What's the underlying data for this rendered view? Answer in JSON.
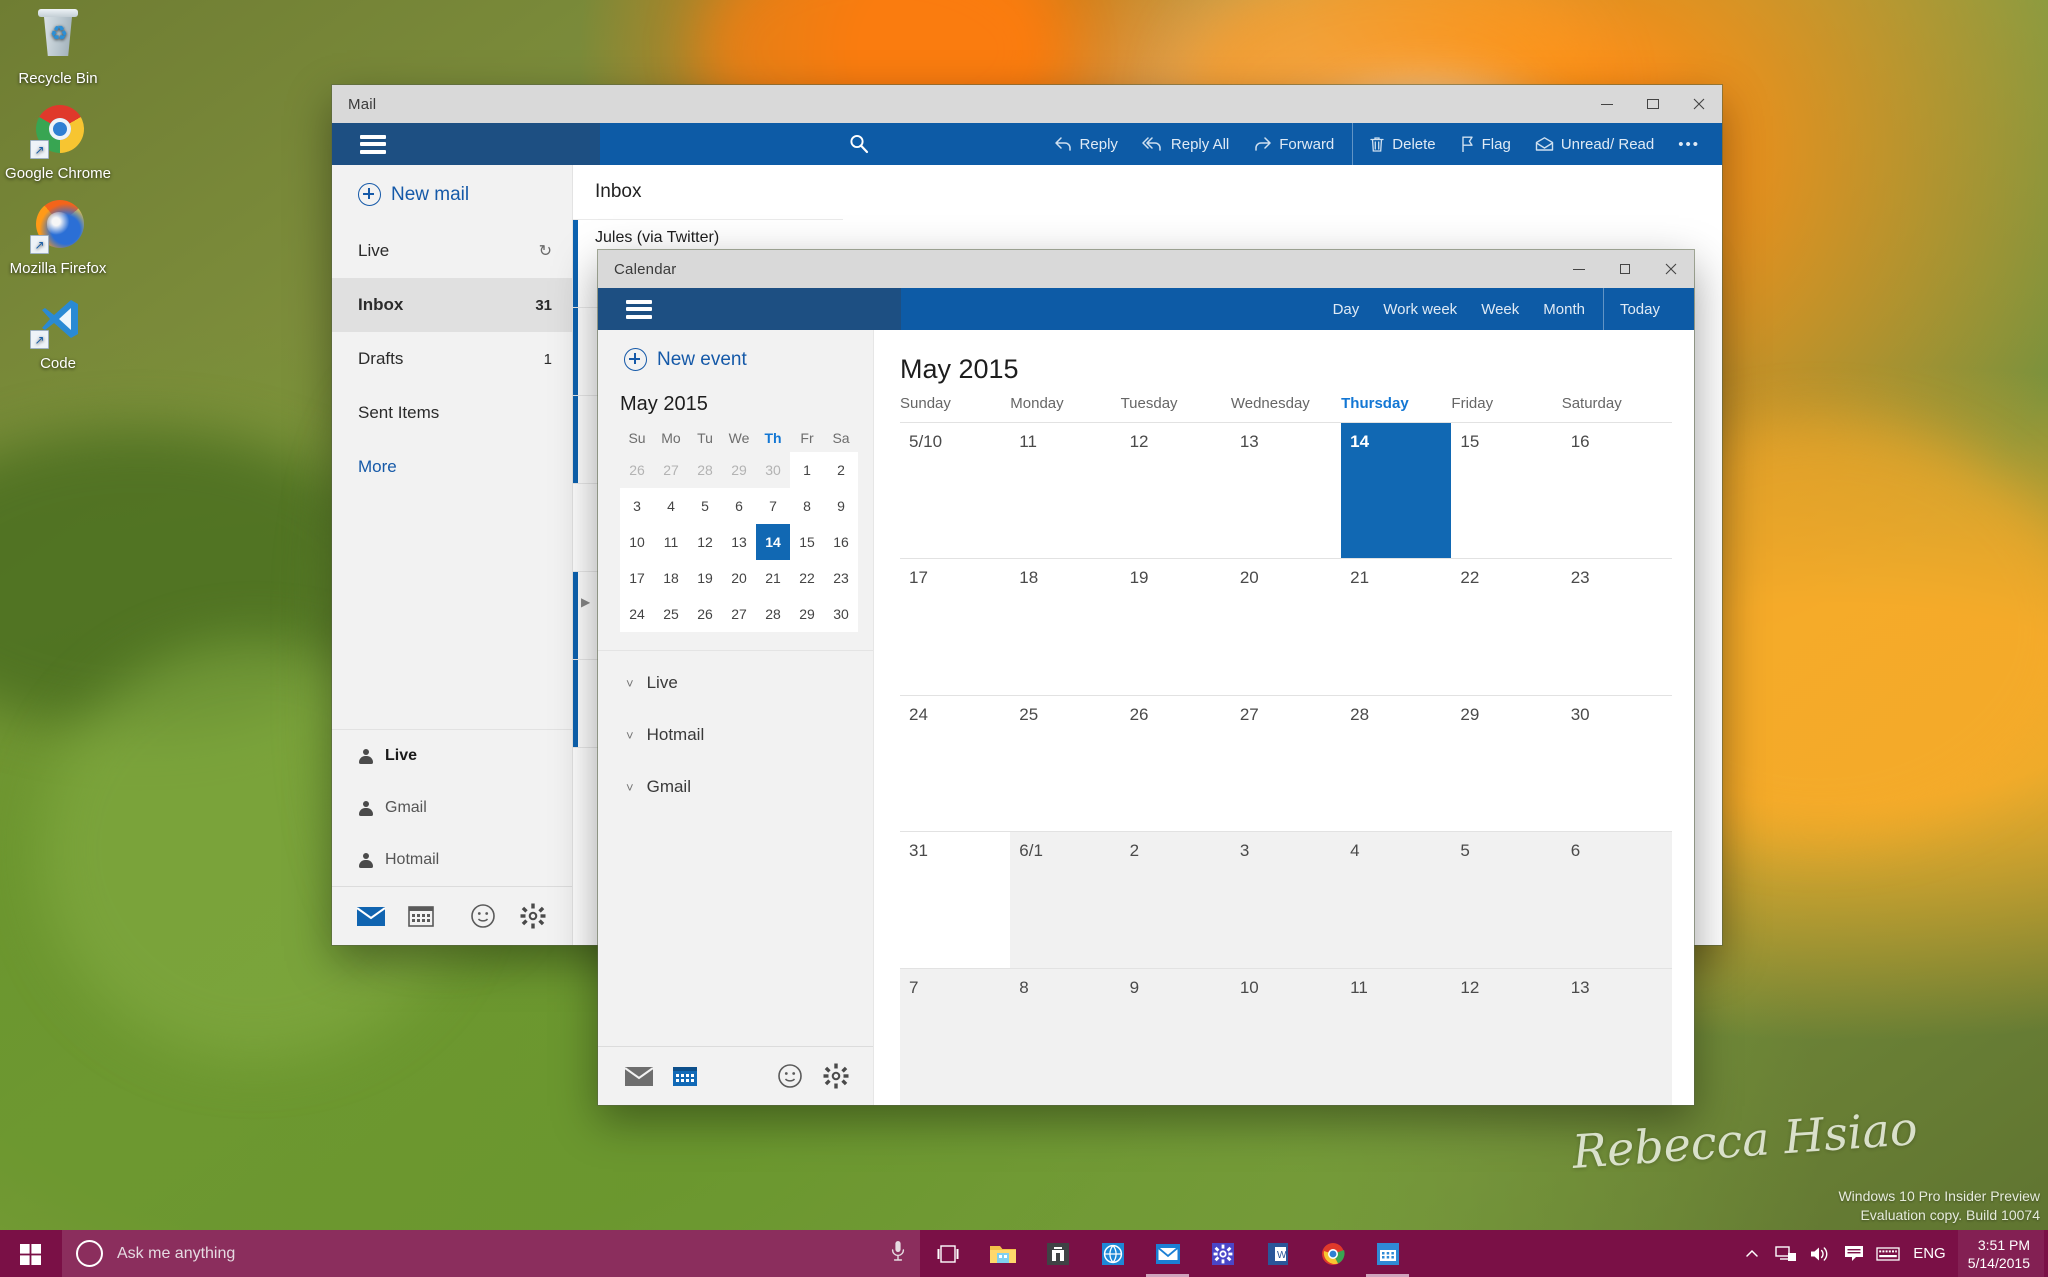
{
  "desktop": {
    "icons": [
      {
        "name": "Recycle Bin",
        "icon": "recycle-bin-icon"
      },
      {
        "name": "Google Chrome",
        "icon": "chrome-icon"
      },
      {
        "name": "Mozilla Firefox",
        "icon": "firefox-icon"
      },
      {
        "name": "Code",
        "icon": "vscode-icon"
      }
    ],
    "watermark_line1": "Windows 10 Pro Insider Preview",
    "watermark_line2": "Evaluation copy. Build 10074",
    "signature": "Rebecca Hsiao"
  },
  "mail_window": {
    "title": "Mail",
    "accent": "#0d5ba6",
    "hamburger_bg": "#1d4f82",
    "controls": {
      "minimize": "–",
      "maximize": "□",
      "close": "✕"
    },
    "menu_icon": "hamburger-icon",
    "search_icon": "search-icon",
    "commands": [
      {
        "label": "Reply",
        "icon": "reply-icon"
      },
      {
        "label": "Reply All",
        "icon": "reply-all-icon"
      },
      {
        "label": "Forward",
        "icon": "forward-icon"
      },
      {
        "label": "Delete",
        "icon": "trash-icon"
      },
      {
        "label": "Flag",
        "icon": "flag-icon"
      },
      {
        "label": "Unread/ Read",
        "icon": "envelope-icon"
      },
      {
        "label": "•••",
        "icon": "more-icon"
      }
    ],
    "new_mail": "New mail",
    "folders": [
      {
        "label": "Live",
        "count": "",
        "selected": false,
        "refresh": true
      },
      {
        "label": "Inbox",
        "count": "31",
        "selected": true,
        "refresh": false
      },
      {
        "label": "Drafts",
        "count": "1",
        "selected": false,
        "refresh": false
      },
      {
        "label": "Sent Items",
        "count": "",
        "selected": false,
        "refresh": false
      },
      {
        "label": "More",
        "count": "",
        "selected": false,
        "refresh": false
      }
    ],
    "accounts": [
      {
        "label": "Live",
        "bold": true
      },
      {
        "label": "Gmail",
        "bold": false
      },
      {
        "label": "Hotmail",
        "bold": false
      }
    ],
    "bottom_bar": [
      {
        "icon": "mail-icon",
        "active": true
      },
      {
        "icon": "calendar-icon",
        "active": false
      },
      {
        "icon": "people-icon",
        "active": false
      },
      {
        "icon": "settings-gear-icon",
        "active": false
      }
    ],
    "list_header": "Inbox",
    "messages": [
      {
        "from": "Jules (via Twitter)",
        "unread": true
      }
    ]
  },
  "calendar_window": {
    "title": "Calendar",
    "accent": "#0d5ba6",
    "controls": {
      "minimize": "–",
      "maximize": "□",
      "close": "✕"
    },
    "menu_icon": "hamburger-icon",
    "views": [
      "Day",
      "Work week",
      "Week",
      "Month"
    ],
    "today_button": "Today",
    "new_event": "New event",
    "mini_calendar": {
      "title": "May 2015",
      "dow": [
        "Su",
        "Mo",
        "Tu",
        "We",
        "Th",
        "Fr",
        "Sa"
      ],
      "highlight_dow": "Th",
      "weeks": [
        [
          {
            "d": "26",
            "out": true
          },
          {
            "d": "27",
            "out": true
          },
          {
            "d": "28",
            "out": true
          },
          {
            "d": "29",
            "out": true
          },
          {
            "d": "30",
            "out": true
          },
          {
            "d": "1",
            "white": true
          },
          {
            "d": "2",
            "white": true
          }
        ],
        [
          {
            "d": "3",
            "white": true
          },
          {
            "d": "4",
            "white": true
          },
          {
            "d": "5",
            "white": true
          },
          {
            "d": "6",
            "white": true
          },
          {
            "d": "7",
            "white": true
          },
          {
            "d": "8",
            "white": true
          },
          {
            "d": "9",
            "white": true
          }
        ],
        [
          {
            "d": "10",
            "white": true
          },
          {
            "d": "11",
            "white": true
          },
          {
            "d": "12",
            "white": true
          },
          {
            "d": "13",
            "white": true
          },
          {
            "d": "14",
            "today": true
          },
          {
            "d": "15",
            "white": true
          },
          {
            "d": "16",
            "white": true
          }
        ],
        [
          {
            "d": "17",
            "white": true
          },
          {
            "d": "18",
            "white": true
          },
          {
            "d": "19",
            "white": true
          },
          {
            "d": "20",
            "white": true
          },
          {
            "d": "21",
            "white": true
          },
          {
            "d": "22",
            "white": true
          },
          {
            "d": "23",
            "white": true
          }
        ],
        [
          {
            "d": "24",
            "white": true
          },
          {
            "d": "25",
            "white": true
          },
          {
            "d": "26",
            "white": true
          },
          {
            "d": "27",
            "white": true
          },
          {
            "d": "28",
            "white": true
          },
          {
            "d": "29",
            "white": true
          },
          {
            "d": "30",
            "white": true
          }
        ]
      ]
    },
    "calendar_accounts": [
      {
        "label": "Live",
        "icon": "chevron-down-icon"
      },
      {
        "label": "Hotmail",
        "icon": "chevron-down-icon"
      },
      {
        "label": "Gmail",
        "icon": "chevron-down-icon"
      }
    ],
    "bottom_bar": [
      {
        "icon": "mail-icon",
        "active": false
      },
      {
        "icon": "calendar-icon",
        "active": true
      },
      {
        "icon": "people-icon",
        "active": false
      },
      {
        "icon": "settings-gear-icon",
        "active": false
      }
    ],
    "month_title": "May 2015",
    "day_names": [
      "Sunday",
      "Monday",
      "Tuesday",
      "Wednesday",
      "Thursday",
      "Friday",
      "Saturday"
    ],
    "highlight_day": "Thursday",
    "grid": [
      [
        {
          "d": "5/10"
        },
        {
          "d": "11"
        },
        {
          "d": "12"
        },
        {
          "d": "13"
        },
        {
          "d": "14",
          "today": true
        },
        {
          "d": "15"
        },
        {
          "d": "16"
        }
      ],
      [
        {
          "d": "17"
        },
        {
          "d": "18"
        },
        {
          "d": "19"
        },
        {
          "d": "20"
        },
        {
          "d": "21"
        },
        {
          "d": "22"
        },
        {
          "d": "23"
        }
      ],
      [
        {
          "d": "24"
        },
        {
          "d": "25"
        },
        {
          "d": "26"
        },
        {
          "d": "27"
        },
        {
          "d": "28"
        },
        {
          "d": "29"
        },
        {
          "d": "30"
        }
      ],
      [
        {
          "d": "31"
        },
        {
          "d": "6/1",
          "next": true
        },
        {
          "d": "2",
          "next": true
        },
        {
          "d": "3",
          "next": true
        },
        {
          "d": "4",
          "next": true
        },
        {
          "d": "5",
          "next": true
        },
        {
          "d": "6",
          "next": true
        }
      ],
      [
        {
          "d": "7",
          "next": true
        },
        {
          "d": "8",
          "next": true
        },
        {
          "d": "9",
          "next": true
        },
        {
          "d": "10",
          "next": true
        },
        {
          "d": "11",
          "next": true
        },
        {
          "d": "12",
          "next": true
        },
        {
          "d": "13",
          "next": true
        }
      ]
    ]
  },
  "taskbar": {
    "start_icon": "windows-start-icon",
    "search_placeholder": "Ask me anything",
    "cortana_icon": "cortana-circle-icon",
    "mic_icon": "microphone-icon",
    "buttons": [
      {
        "icon": "task-view-icon",
        "active": false
      },
      {
        "icon": "file-explorer-icon",
        "active": false
      },
      {
        "icon": "store-icon",
        "active": false
      },
      {
        "icon": "edge-icon",
        "active": false
      },
      {
        "icon": "mail-app-icon",
        "active": true
      },
      {
        "icon": "settings-app-icon",
        "active": false
      },
      {
        "icon": "word-icon",
        "active": false
      },
      {
        "icon": "chrome-app-icon",
        "active": false
      },
      {
        "icon": "calendar-app-icon",
        "active": true
      }
    ],
    "tray": [
      {
        "icon": "show-hidden-icons-icon"
      },
      {
        "icon": "network-icon"
      },
      {
        "icon": "volume-icon"
      },
      {
        "icon": "action-center-icon"
      },
      {
        "icon": "keyboard-icon"
      }
    ],
    "language": "ENG",
    "time": "3:51 PM",
    "date": "5/14/2015"
  }
}
